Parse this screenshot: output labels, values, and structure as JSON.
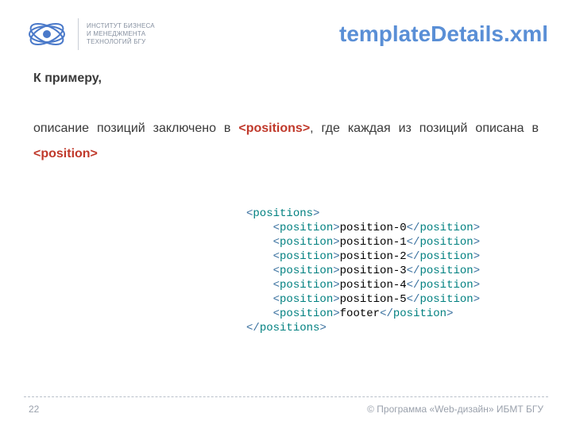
{
  "header": {
    "institute_line1": "ИНСТИТУТ БИЗНЕСА",
    "institute_line2": "И МЕНЕДЖМЕНТА",
    "institute_line3": "ТЕХНОЛОГИЙ БГУ",
    "title": "templateDetails.xml"
  },
  "body": {
    "intro": "К примеру,",
    "desc_part1": "описание позиций заключено в ",
    "tag1": "<positions>",
    "desc_part2": ", где каждая из позиций описана в ",
    "tag2": "<position>"
  },
  "code": {
    "open_positions": "<positions>",
    "close_positions": "</positions>",
    "open_position": "<position>",
    "close_position": "</position>",
    "items": [
      "position-0",
      "position-1",
      "position-2",
      "position-3",
      "position-4",
      "position-5",
      "footer"
    ]
  },
  "footer": {
    "page": "22",
    "credit": "© Программа «Web-дизайн» ИБМТ БГУ"
  }
}
